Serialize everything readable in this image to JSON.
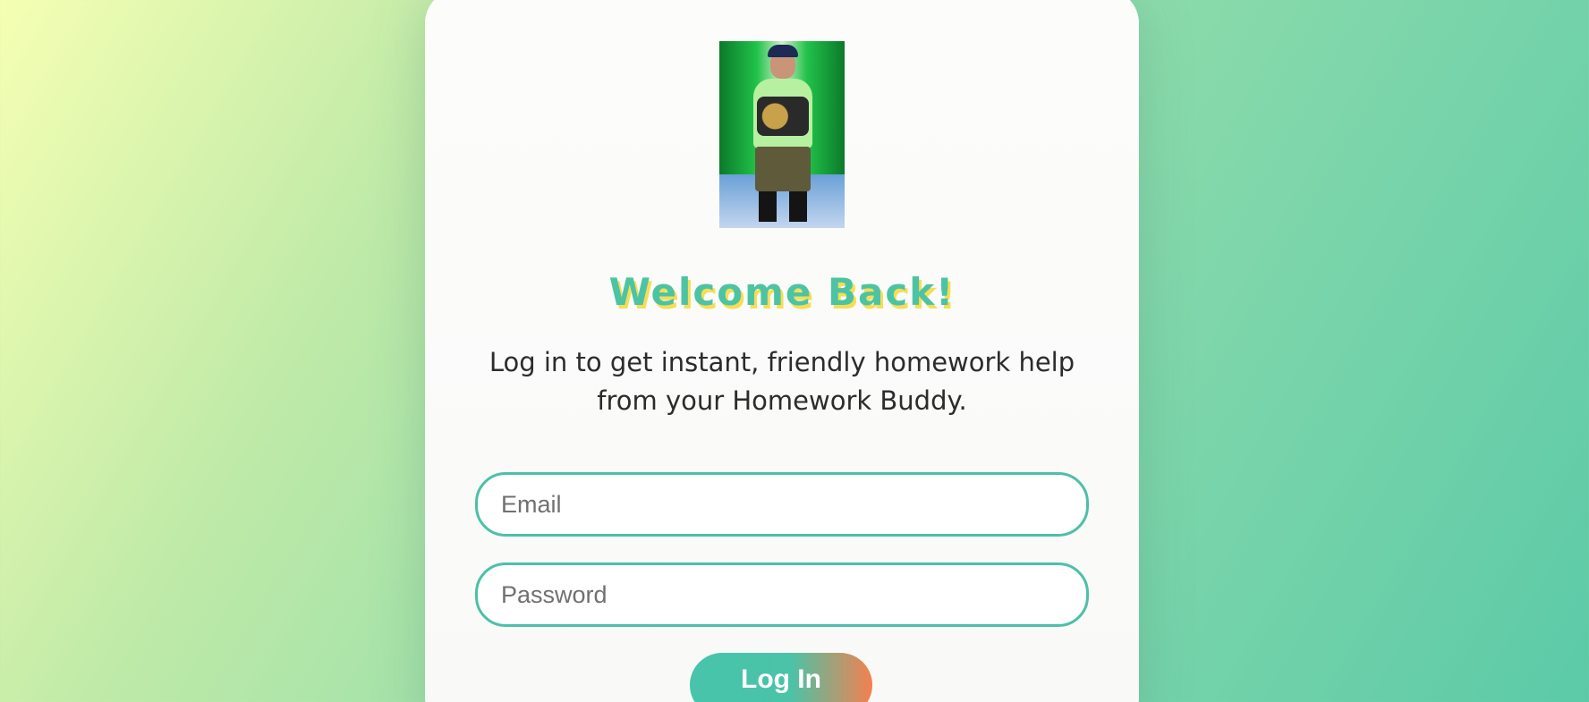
{
  "card": {
    "avatar_name": "profile-photo",
    "title": "Welcome Back!",
    "subtitle": "Log in to get instant, friendly homework help from your Homework Buddy."
  },
  "form": {
    "email_placeholder": "Email",
    "email_value": "",
    "password_placeholder": "Password",
    "password_value": "",
    "login_label": "Log In"
  },
  "colors": {
    "accent": "#4cc4a4",
    "title_shadow": "#f7dd55",
    "button_end": "#f4804f"
  }
}
